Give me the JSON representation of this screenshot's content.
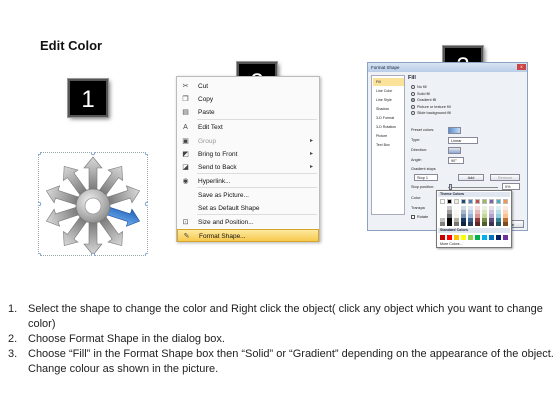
{
  "title": "Edit Color",
  "steps": {
    "one": "1",
    "two": "2",
    "three": "3"
  },
  "context_menu": {
    "items": [
      {
        "label": "Cut",
        "icon": "scissors-icon",
        "glyph": "✂",
        "submenu": false,
        "disabled": false,
        "highlight": false
      },
      {
        "label": "Copy",
        "icon": "copy-icon",
        "glyph": "❐",
        "submenu": false,
        "disabled": false,
        "highlight": false
      },
      {
        "label": "Paste",
        "icon": "paste-icon",
        "glyph": "▤",
        "submenu": false,
        "disabled": false,
        "highlight": false
      },
      {
        "label": "Edit Text",
        "icon": "edit-text-icon",
        "glyph": "A",
        "submenu": false,
        "disabled": false,
        "highlight": false
      },
      {
        "label": "Group",
        "icon": "group-icon",
        "glyph": "▣",
        "submenu": true,
        "disabled": true,
        "highlight": false
      },
      {
        "label": "Bring to Front",
        "icon": "bring-to-front-icon",
        "glyph": "◩",
        "submenu": true,
        "disabled": false,
        "highlight": false
      },
      {
        "label": "Send to Back",
        "icon": "send-to-back-icon",
        "glyph": "◪",
        "submenu": true,
        "disabled": false,
        "highlight": false
      },
      {
        "label": "Hyperlink...",
        "icon": "hyperlink-icon",
        "glyph": "◉",
        "submenu": false,
        "disabled": false,
        "highlight": false
      },
      {
        "label": "Save as Picture...",
        "icon": "",
        "glyph": "",
        "submenu": false,
        "disabled": false,
        "highlight": false
      },
      {
        "label": "Set as Default Shape",
        "icon": "",
        "glyph": "",
        "submenu": false,
        "disabled": false,
        "highlight": false
      },
      {
        "label": "Size and Position...",
        "icon": "size-position-icon",
        "glyph": "⊡",
        "submenu": false,
        "disabled": false,
        "highlight": false
      },
      {
        "label": "Format Shape...",
        "icon": "format-shape-icon",
        "glyph": "✎",
        "submenu": false,
        "disabled": false,
        "highlight": true
      }
    ]
  },
  "dialog": {
    "title": "Format Shape",
    "close_glyph": "x",
    "categories": [
      "Fill",
      "Line Color",
      "Line Style",
      "Shadow",
      "3-D Format",
      "3-D Rotation",
      "Picture",
      "Text Box"
    ],
    "active_category": 0,
    "pane_heading": "Fill",
    "fill_options": [
      {
        "label": "No fill",
        "selected": false
      },
      {
        "label": "Solid fill",
        "selected": false
      },
      {
        "label": "Gradient fill",
        "selected": true
      },
      {
        "label": "Picture or texture fill",
        "selected": false
      },
      {
        "label": "Slide background fill",
        "selected": false
      }
    ],
    "fields": {
      "preset_colors": "Preset colors:",
      "type": "Type:",
      "type_value": "Linear",
      "direction": "Direction:",
      "angle": "Angle:",
      "angle_value": "90°",
      "gradient_stops": "Gradient stops",
      "stop_value": "Stop 1",
      "add_button": "Add",
      "remove_button": "Remove",
      "stop_position": "Stop position:",
      "stop_position_value": "0%",
      "color": "Color:",
      "transparency": "Transpa",
      "rotate": "Rotate"
    },
    "close_button": "Close"
  },
  "palette": {
    "theme_heading": "Theme Colors",
    "standard_heading": "Standard Colors",
    "more_colors": "More Colors...",
    "theme_top": [
      "#ffffff",
      "#000000",
      "#eeece1",
      "#1f497d",
      "#4f81bd",
      "#c0504d",
      "#9bbb59",
      "#8064a2",
      "#4bacc6",
      "#f79646"
    ],
    "standard": [
      "#c00000",
      "#ff0000",
      "#ffc000",
      "#ffff00",
      "#92d050",
      "#00b050",
      "#00b0f0",
      "#0070c0",
      "#002060",
      "#7030a0"
    ]
  },
  "instructions": [
    {
      "num": "1.",
      "text": "Select the shape to change the color and Right click the object( click any object which you want to change color)"
    },
    {
      "num": "2.",
      "text": "Choose Format Shape in the dialog box."
    },
    {
      "num": "3.",
      "text": "Choose “Fill” in the Format Shape box then “Solid” or “Gradient” depending on the appearance of the object. Change colour as shown in the picture."
    }
  ],
  "colors": {
    "highlight": "#f7c94d",
    "selected_arrow": "#2e75d6",
    "arrow_gray": "#9a9a9a",
    "dialog_bg": "#eef1f5"
  }
}
